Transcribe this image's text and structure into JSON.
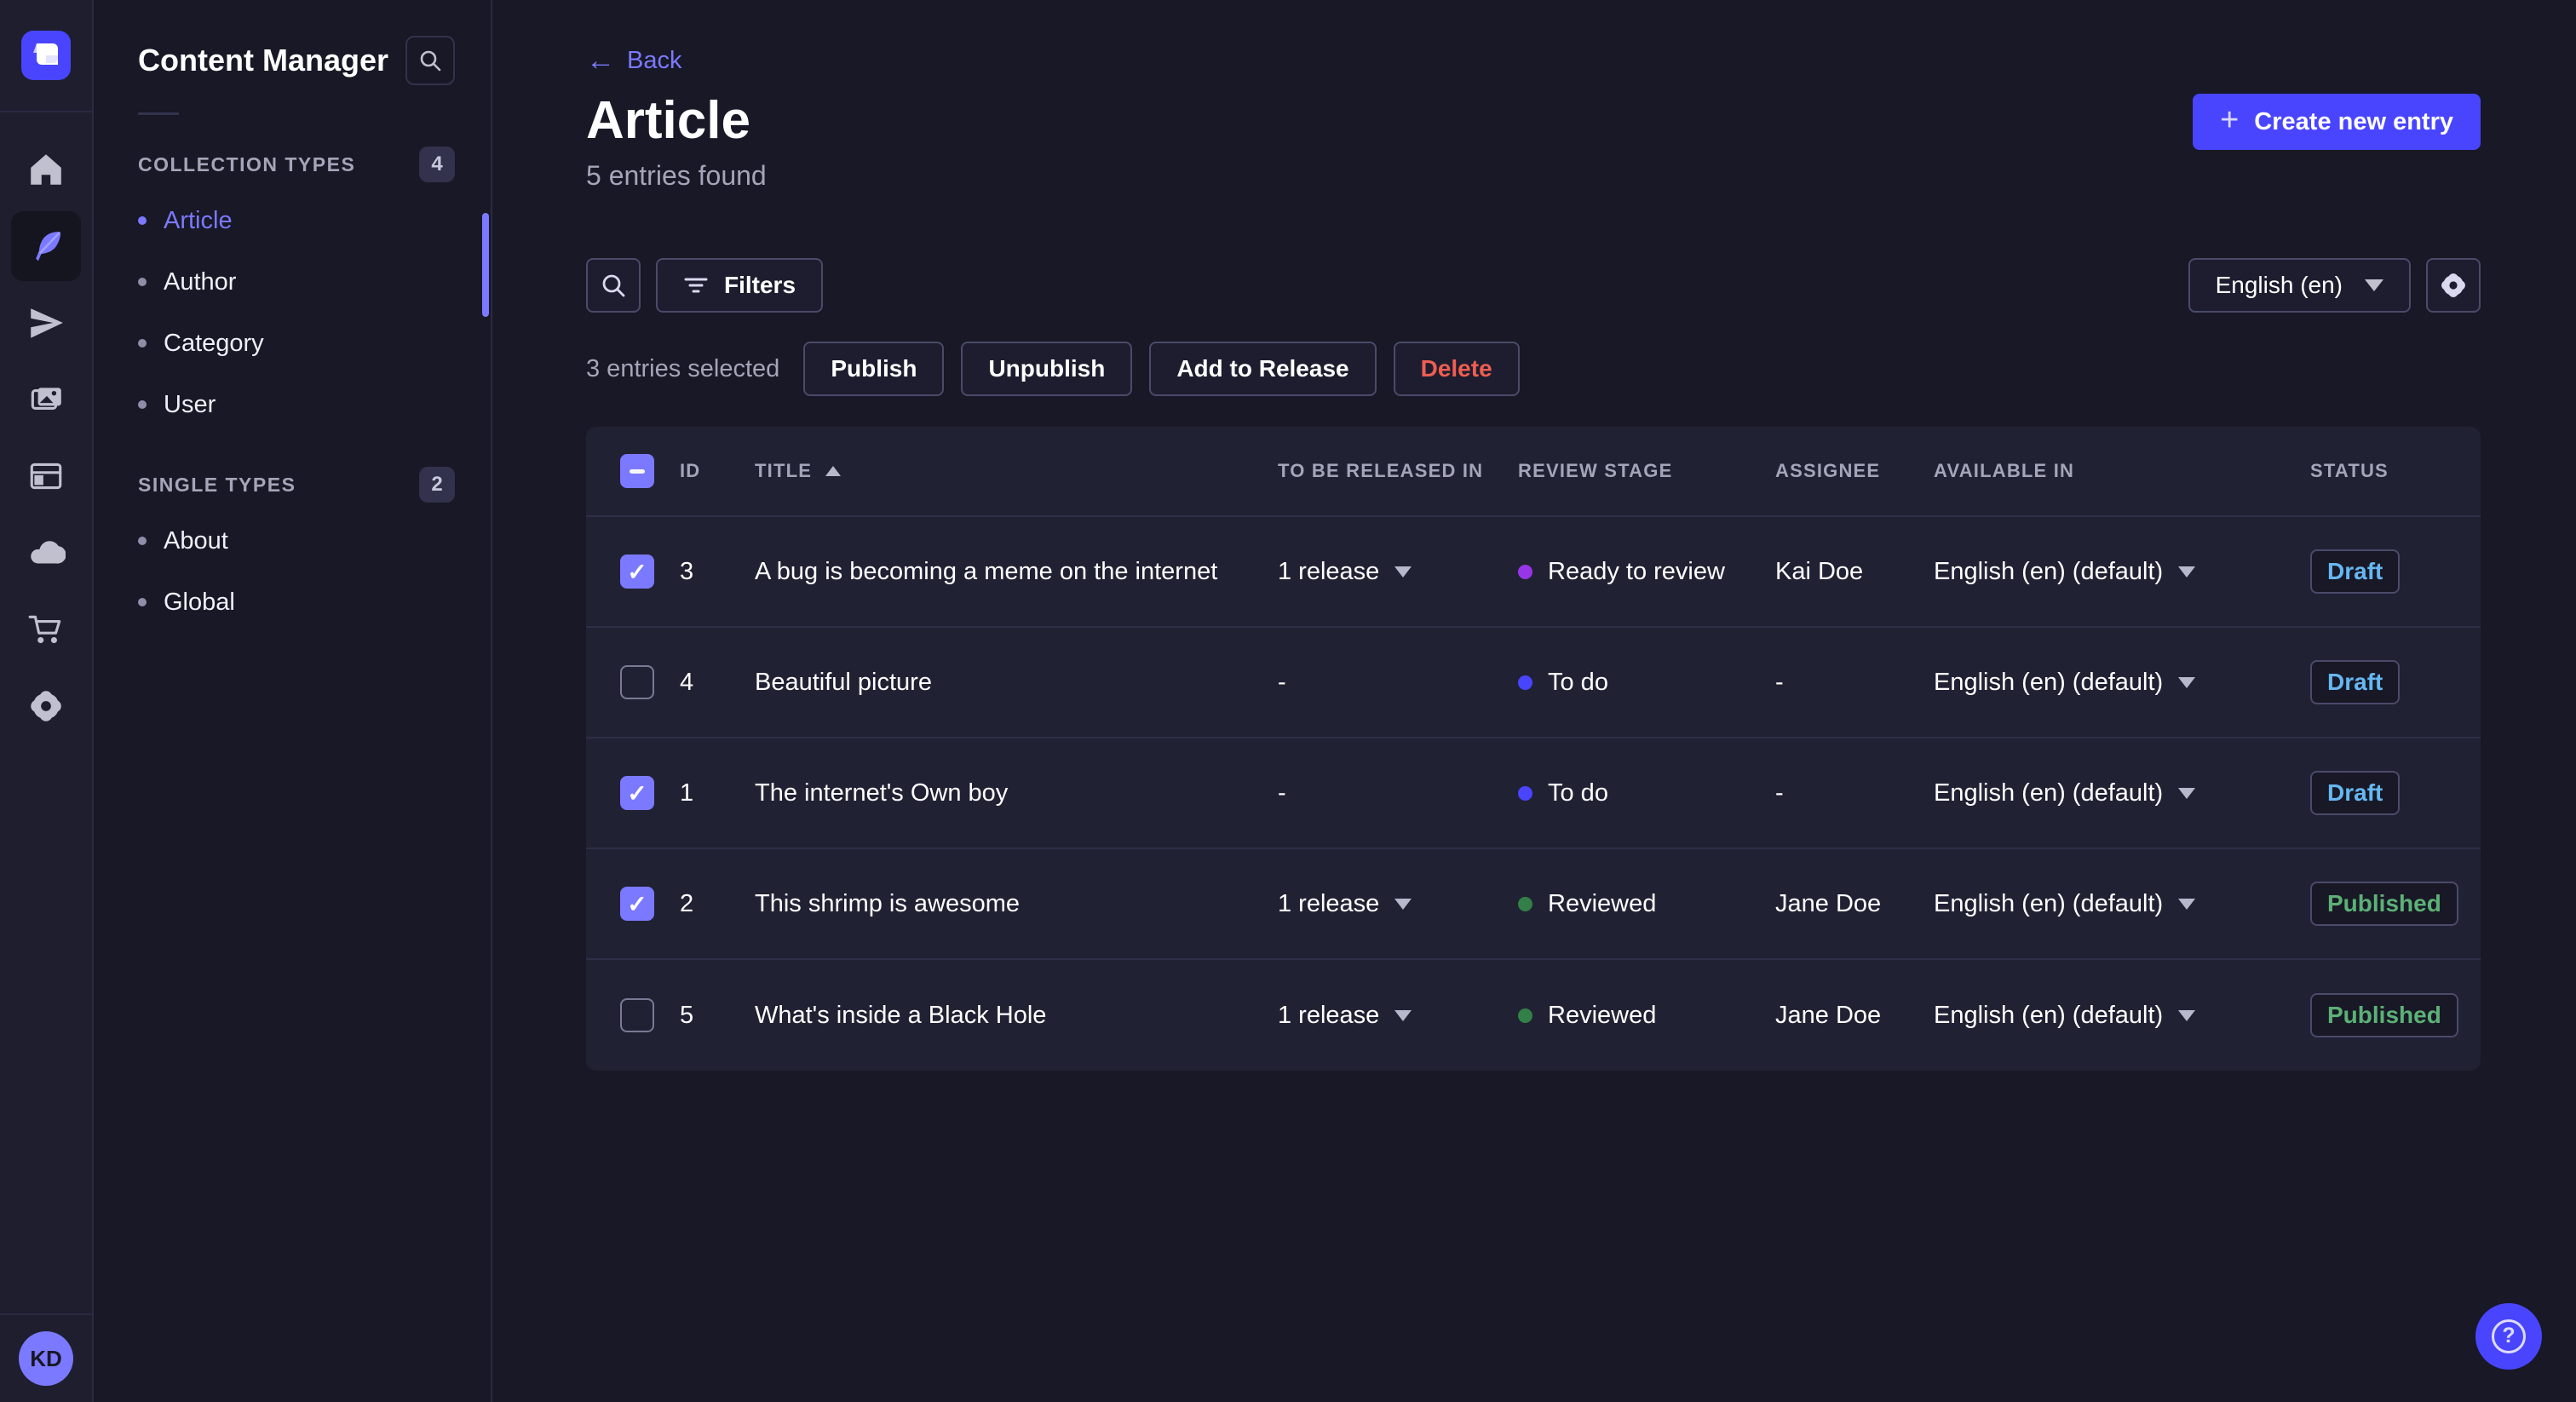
{
  "app": {
    "name": "Strapi Content Manager"
  },
  "rail": {
    "icons": [
      "home",
      "content-manager-feather",
      "releases-paper-plane",
      "media-library-images",
      "content-type-builder-layout",
      "deploy-cloud",
      "marketplace-cart",
      "settings-gear"
    ],
    "avatar_initials": "KD"
  },
  "sidebar": {
    "title": "Content Manager",
    "search_icon": "search-icon",
    "sections": [
      {
        "label": "COLLECTION TYPES",
        "count": "4",
        "items": [
          {
            "label": "Article",
            "active": true
          },
          {
            "label": "Author",
            "active": false
          },
          {
            "label": "Category",
            "active": false
          },
          {
            "label": "User",
            "active": false
          }
        ]
      },
      {
        "label": "SINGLE TYPES",
        "count": "2",
        "items": [
          {
            "label": "About",
            "active": false
          },
          {
            "label": "Global",
            "active": false
          }
        ]
      }
    ]
  },
  "header": {
    "back_label": "Back",
    "title": "Article",
    "subtitle": "5 entries found",
    "create_button_label": "Create new entry"
  },
  "toolbar": {
    "filters_label": "Filters",
    "locale_value": "English (en)"
  },
  "selection": {
    "text": "3 entries selected",
    "publish_label": "Publish",
    "unpublish_label": "Unpublish",
    "add_to_release_label": "Add to Release",
    "delete_label": "Delete"
  },
  "table": {
    "header_check_state": "indeterminate",
    "columns": {
      "id": "ID",
      "title": "TITLE",
      "released": "TO BE RELEASED IN",
      "review": "REVIEW STAGE",
      "assignee": "ASSIGNEE",
      "available": "AVAILABLE IN",
      "status": "STATUS"
    },
    "sort": {
      "column": "TITLE",
      "direction": "ascending"
    },
    "rows": [
      {
        "check_state": "checked",
        "id": "3",
        "title": "A bug is becoming a meme on the internet",
        "released_in": "1 release",
        "released_state": "released-menu",
        "review_stage": "Ready to review",
        "stage_color": "#9736e8",
        "assignee": "Kai Doe",
        "available_in": "English (en) (default)",
        "status": "Draft",
        "status_class": "draft"
      },
      {
        "check_state": "unchecked",
        "id": "4",
        "title": "Beautiful picture",
        "released_in": "-",
        "released_state": "released-empty",
        "review_stage": "To do",
        "stage_color": "#4945ff",
        "assignee": "-",
        "available_in": "English (en) (default)",
        "status": "Draft",
        "status_class": "draft"
      },
      {
        "check_state": "checked",
        "id": "1",
        "title": "The internet's Own boy",
        "released_in": "-",
        "released_state": "released-empty",
        "review_stage": "To do",
        "stage_color": "#4945ff",
        "assignee": "-",
        "available_in": "English (en) (default)",
        "status": "Draft",
        "status_class": "draft"
      },
      {
        "check_state": "checked",
        "id": "2",
        "title": "This shrimp is awesome",
        "released_in": "1 release",
        "released_state": "released-menu",
        "review_stage": "Reviewed",
        "stage_color": "#328048",
        "assignee": "Jane Doe",
        "available_in": "English (en) (default)",
        "status": "Published",
        "status_class": "published"
      },
      {
        "check_state": "unchecked",
        "id": "5",
        "title": "What's inside a Black Hole",
        "released_in": "1 release",
        "released_state": "released-menu",
        "review_stage": "Reviewed",
        "stage_color": "#328048",
        "assignee": "Jane Doe",
        "available_in": "English (en) (default)",
        "status": "Published",
        "status_class": "published"
      }
    ]
  },
  "colors": {
    "primary": "#4945ff",
    "primary_light": "#7b79ff",
    "draft_text": "#66b7f1",
    "published_text": "#5cb176",
    "danger_text": "#ee5e52",
    "surface": "#212134",
    "background": "#181826",
    "border": "#32324d"
  }
}
